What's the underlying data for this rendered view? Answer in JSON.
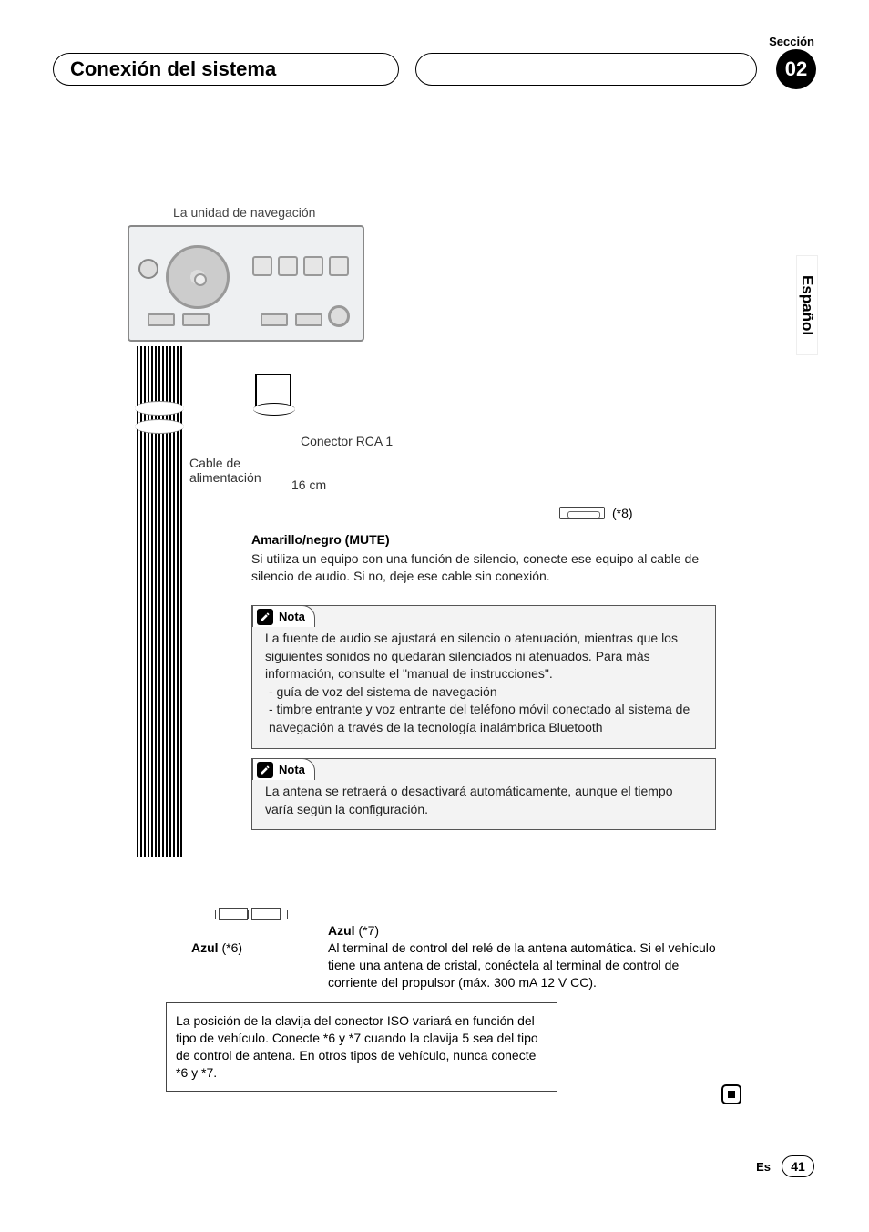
{
  "header": {
    "section_label": "Sección",
    "title": "Conexión del sistema",
    "section_number": "02"
  },
  "lang_tab": "Español",
  "labels": {
    "nav_unit": "La unidad de navegación",
    "rca": "Conector RCA 1",
    "power_cable": "Cable de\nalimentación",
    "length": "16 cm",
    "fuse_ref": "(*8)"
  },
  "mute": {
    "title": "Amarillo/negro (MUTE)",
    "body": "Si utiliza un equipo con una función de silencio, conecte ese equipo al cable de silencio de audio. Si no, deje ese cable sin conexión."
  },
  "note1": {
    "label": "Nota",
    "body": "La fuente de audio se ajustará en silencio o atenuación, mientras que los siguientes sonidos no quedarán silenciados ni atenuados. Para más información, consulte el \"manual de instrucciones\".",
    "item1": "- guía de voz del sistema de navegación",
    "item2": "- timbre entrante y voz entrante del teléfono móvil conectado al sistema de navegación a través de la tecnología inalámbrica Bluetooth"
  },
  "note2": {
    "label": "Nota",
    "body": "La antena se retraerá o desactivará automáticamente, aunque el tiempo varía según la configuración."
  },
  "azul": {
    "ref6_label": "Azul",
    "ref6_suffix": " (*6)",
    "ref7_label": "Azul",
    "ref7_suffix": " (*7)",
    "ref7_body": "Al terminal de control del relé de la antena automática. Si el vehículo tiene una antena de cristal, conéctela al terminal de control de corriente del propulsor (máx. 300 mA 12 V CC)."
  },
  "iso_note": "La posición de la clavija del conector ISO variará en función del tipo de vehículo. Conecte *6 y *7 cuando la clavija 5 sea del tipo de control de antena. En otros tipos de vehículo, nunca conecte *6 y *7.",
  "footer": {
    "lang": "Es",
    "page": "41"
  }
}
